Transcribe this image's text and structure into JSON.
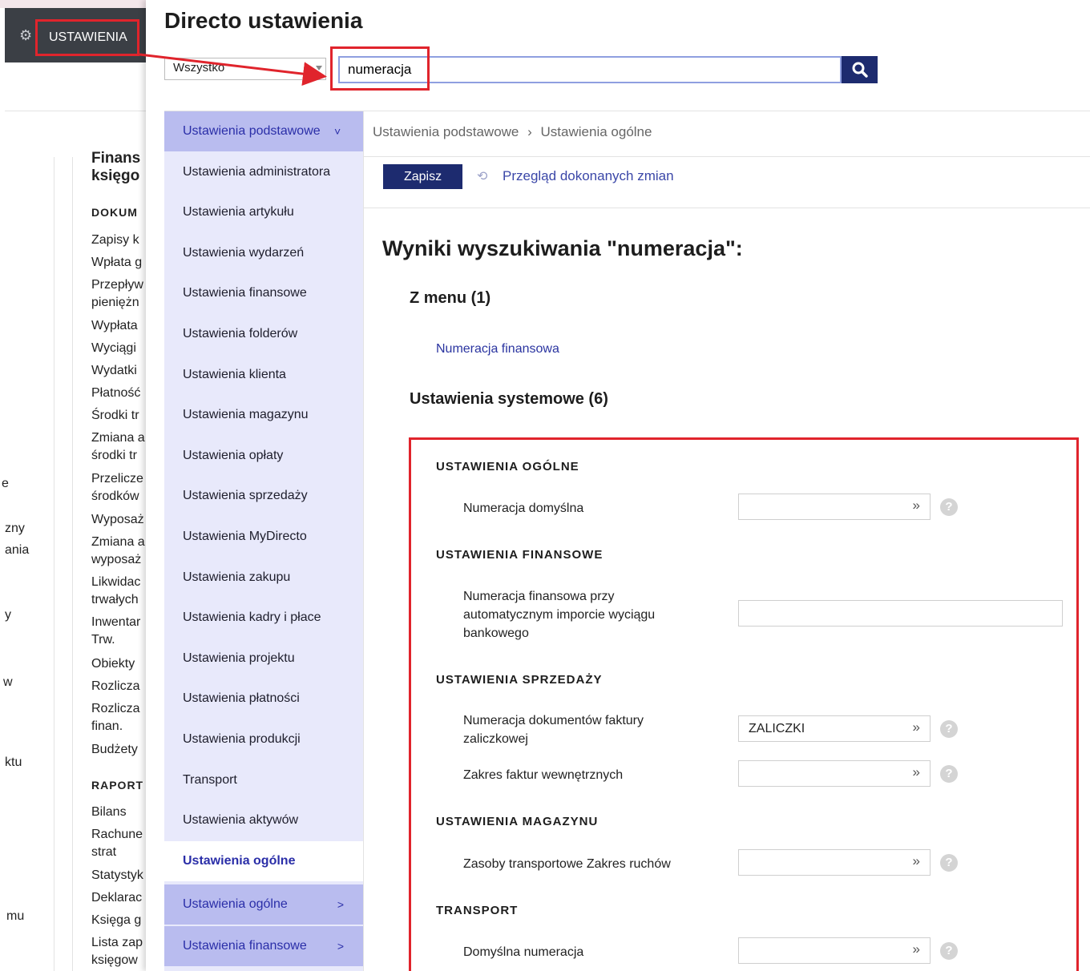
{
  "background": {
    "topbar_label": "USTAWIENIA",
    "menu_heading": "Finans\nksięgo",
    "menu_section_docs": "DOKUM",
    "menu_items": [
      "Zapisy k",
      "Wpłata g",
      "Przepływ",
      "pieniężn",
      "Wypłata",
      "Wyciągi",
      "Wydatki",
      "Płatność",
      "Środki tr",
      "Zmiana a",
      "środki tr",
      "Przelicze",
      "środków",
      "Wyposaż",
      "Zmiana a",
      "wyposaż",
      "Likwidac",
      "trwałych",
      "Inwentar",
      "Trw.",
      "Obiekty",
      "Rozlicza",
      "Rozlicza",
      "finan.",
      "Budżety"
    ],
    "menu_section_reports": "RAPORT",
    "report_items": [
      "Bilans",
      "Rachune",
      "strat",
      "Statystyk",
      "Deklarac",
      "Księga g",
      "Lista zap",
      "księgow"
    ],
    "left_fragments": [
      "e",
      "zny",
      "ania",
      "y",
      "w",
      "ktu",
      "mu"
    ]
  },
  "panel": {
    "title": "Directo ustawienia",
    "scope_select": "Wszystko",
    "search_value": "numeracja"
  },
  "nav": {
    "items": [
      {
        "label": "Ustawienia podstawowe",
        "type": "parent",
        "chevron": "˅"
      },
      {
        "label": "Ustawienia administratora",
        "type": "child"
      },
      {
        "label": "Ustawienia artykułu",
        "type": "child"
      },
      {
        "label": "Ustawienia wydarzeń",
        "type": "child"
      },
      {
        "label": "Ustawienia finansowe",
        "type": "child"
      },
      {
        "label": "Ustawienia folderów",
        "type": "child"
      },
      {
        "label": "Ustawienia klienta",
        "type": "child"
      },
      {
        "label": "Ustawienia magazynu",
        "type": "child"
      },
      {
        "label": "Ustawienia opłaty",
        "type": "child"
      },
      {
        "label": "Ustawienia sprzedaży",
        "type": "child"
      },
      {
        "label": "Ustawienia MyDirecto",
        "type": "child"
      },
      {
        "label": "Ustawienia zakupu",
        "type": "child"
      },
      {
        "label": "Ustawienia kadry i płace",
        "type": "child"
      },
      {
        "label": "Ustawienia projektu",
        "type": "child"
      },
      {
        "label": "Ustawienia płatności",
        "type": "child"
      },
      {
        "label": "Ustawienia produkcji",
        "type": "child"
      },
      {
        "label": "Transport",
        "type": "child"
      },
      {
        "label": "Ustawienia aktywów",
        "type": "child"
      },
      {
        "label": "Ustawienia ogólne",
        "type": "active"
      },
      {
        "label": "Ustawienia ogólne",
        "type": "parent",
        "chevron": ">"
      },
      {
        "label": "Ustawienia finansowe",
        "type": "parent",
        "chevron": ">"
      }
    ]
  },
  "breadcrumb": {
    "level1": "Ustawienia podstawowe",
    "sep": "›",
    "level2": "Ustawienia ogólne"
  },
  "toolbar": {
    "save_label": "Zapisz",
    "history_label": "Przegląd dokonanych zmian"
  },
  "results": {
    "title": "Wyniki wyszukiwania \"numeracja\":",
    "menu_heading": "Z menu (1)",
    "menu_link": "Numeracja finansowa",
    "system_heading": "Ustawienia systemowe (6)",
    "groups": [
      {
        "title": "USTAWIENIA OGÓLNE",
        "fields": [
          {
            "label": "Numeracja domyślna",
            "value": ""
          }
        ]
      },
      {
        "title": "USTAWIENIA FINANSOWE",
        "fields": [
          {
            "label": "Numeracja finansowa przy automatycznym imporcie wyciągu bankowego",
            "value": ""
          }
        ]
      },
      {
        "title": "USTAWIENIA SPRZEDAŻY",
        "fields": [
          {
            "label": "Numeracja dokumentów faktury zaliczkowej",
            "value": "ZALICZKI"
          },
          {
            "label": "Zakres faktur wewnętrznych",
            "value": ""
          }
        ]
      },
      {
        "title": "USTAWIENIA MAGAZYNU",
        "fields": [
          {
            "label": "Zasoby transportowe Zakres ruchów",
            "value": ""
          }
        ]
      },
      {
        "title": "TRANSPORT",
        "fields": [
          {
            "label": "Domyślna numeracja",
            "value": ""
          }
        ]
      }
    ],
    "picker_glyph": "»",
    "help_glyph": "?"
  },
  "colors": {
    "accent": "#1d2b6f",
    "highlight": "#e0242c",
    "nav_bg": "#e8e9fb",
    "nav_parent": "#b9bcef",
    "link": "#2a34a0"
  }
}
